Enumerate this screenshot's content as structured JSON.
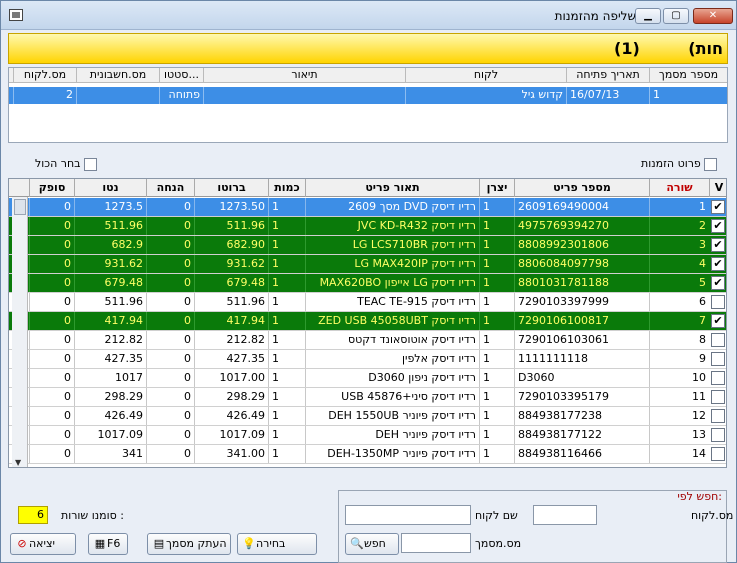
{
  "window": {
    "title": "שליפה מהזמנות",
    "minimize": "▁",
    "maximize": "▢",
    "close": "✕"
  },
  "banner": {
    "title": "חות)",
    "count": "(1)"
  },
  "orders": {
    "headers": [
      "מספר מסמך",
      "תאריך פתיחה",
      "לקוח",
      "תיאור",
      "סטטו...",
      "מס.חשבונית",
      "מס.לקוח"
    ],
    "row": [
      "1",
      "16/07/13",
      "קדוש גיל",
      "",
      "פתוחה",
      "",
      "2"
    ]
  },
  "options": {
    "order_details": "פרוט הזמנות",
    "select_all": "בחר הכול"
  },
  "grid": {
    "headers": [
      "V",
      "שורה",
      "מספר פריט",
      "יצרן",
      "תאור פריט",
      "כמות",
      "ברוטו",
      "הנחה",
      "נטו",
      "סופק"
    ],
    "rows": [
      {
        "line": "1",
        "item": "2609169490004",
        "maker": "1",
        "desc": "רדיו דיסק DVD מסך 2609",
        "qty": "1",
        "gross": "1273.50",
        "disc": "0",
        "net": "1273.5",
        "supplied": "0",
        "checked": "✔",
        "style": "sel"
      },
      {
        "line": "2",
        "item": "4975769394270",
        "maker": "1",
        "desc": "רדיו דיסק JVC KD-R432",
        "qty": "1",
        "gross": "511.96",
        "disc": "0",
        "net": "511.96",
        "supplied": "0",
        "checked": "✔",
        "style": "green"
      },
      {
        "line": "3",
        "item": "8808992301806",
        "maker": "1",
        "desc": "רדיו דיסק LG LCS710BR",
        "qty": "1",
        "gross": "682.90",
        "disc": "0",
        "net": "682.9",
        "supplied": "0",
        "checked": "✔",
        "style": "green"
      },
      {
        "line": "4",
        "item": "8806084097798",
        "maker": "1",
        "desc": "רדיו דיסק LG MAX420IP",
        "qty": "1",
        "gross": "931.62",
        "disc": "0",
        "net": "931.62",
        "supplied": "0",
        "checked": "✔",
        "style": "green"
      },
      {
        "line": "5",
        "item": "8801031781188",
        "maker": "1",
        "desc": "רדיו דיסק LG אייפון MAX620BO",
        "qty": "1",
        "gross": "679.48",
        "disc": "0",
        "net": "679.48",
        "supplied": "0",
        "checked": "✔",
        "style": "green"
      },
      {
        "line": "6",
        "item": "7290103397999",
        "maker": "1",
        "desc": "רדיו דיסק TEAC TE-915",
        "qty": "1",
        "gross": "511.96",
        "disc": "0",
        "net": "511.96",
        "supplied": "0",
        "checked": "",
        "style": ""
      },
      {
        "line": "7",
        "item": "7290106100817",
        "maker": "1",
        "desc": "רדיו דיסק ZED USB 45058UBT",
        "qty": "1",
        "gross": "417.94",
        "disc": "0",
        "net": "417.94",
        "supplied": "0",
        "checked": "✔",
        "style": "green"
      },
      {
        "line": "8",
        "item": "7290106103061",
        "maker": "1",
        "desc": "רדיו דיסק אוטוסאונד דקטס",
        "qty": "1",
        "gross": "212.82",
        "disc": "0",
        "net": "212.82",
        "supplied": "0",
        "checked": "",
        "style": ""
      },
      {
        "line": "9",
        "item": "1111111118",
        "maker": "1",
        "desc": "רדיו דיסק אלפין",
        "qty": "1",
        "gross": "427.35",
        "disc": "0",
        "net": "427.35",
        "supplied": "0",
        "checked": "",
        "style": ""
      },
      {
        "line": "10",
        "item": "D3060",
        "maker": "1",
        "desc": "רדיו דיסק ניפון D3060",
        "qty": "1",
        "gross": "1017.00",
        "disc": "0",
        "net": "1017",
        "supplied": "0",
        "checked": "",
        "style": ""
      },
      {
        "line": "11",
        "item": "7290103395179",
        "maker": "1",
        "desc": "רדיו דיסק סיני+USB 45876",
        "qty": "1",
        "gross": "298.29",
        "disc": "0",
        "net": "298.29",
        "supplied": "0",
        "checked": "",
        "style": ""
      },
      {
        "line": "12",
        "item": "884938177238",
        "maker": "1",
        "desc": "רדיו דיסק פיוניר DEH 1550UB",
        "qty": "1",
        "gross": "426.49",
        "disc": "0",
        "net": "426.49",
        "supplied": "0",
        "checked": "",
        "style": ""
      },
      {
        "line": "13",
        "item": "884938177122",
        "maker": "1",
        "desc": "רדיו דיסק פיוניר DEH",
        "qty": "1",
        "gross": "1017.09",
        "disc": "0",
        "net": "1017.09",
        "supplied": "0",
        "checked": "",
        "style": ""
      },
      {
        "line": "14",
        "item": "884938116466",
        "maker": "1",
        "desc": "רדיו דיסק פיוניר DEH-1350MP",
        "qty": "1",
        "gross": "341.00",
        "disc": "0",
        "net": "341",
        "supplied": "0",
        "checked": "",
        "style": ""
      }
    ]
  },
  "search": {
    "title": "חפש לפי:",
    "customer_no_label": "מס.לקוח",
    "customer_name_label": "שם לקוח",
    "doc_no_label": "מס.מסמך",
    "search_button": "חפש",
    "search_icon": "magnifier-icon"
  },
  "footer": {
    "marked_rows_label": "סומנו שורות :",
    "marked_rows_value": "6",
    "select_button": "בחירה",
    "copy_doc_button": "העתק מסמך",
    "f6_button": "F6",
    "exit_button": "יציאה"
  }
}
